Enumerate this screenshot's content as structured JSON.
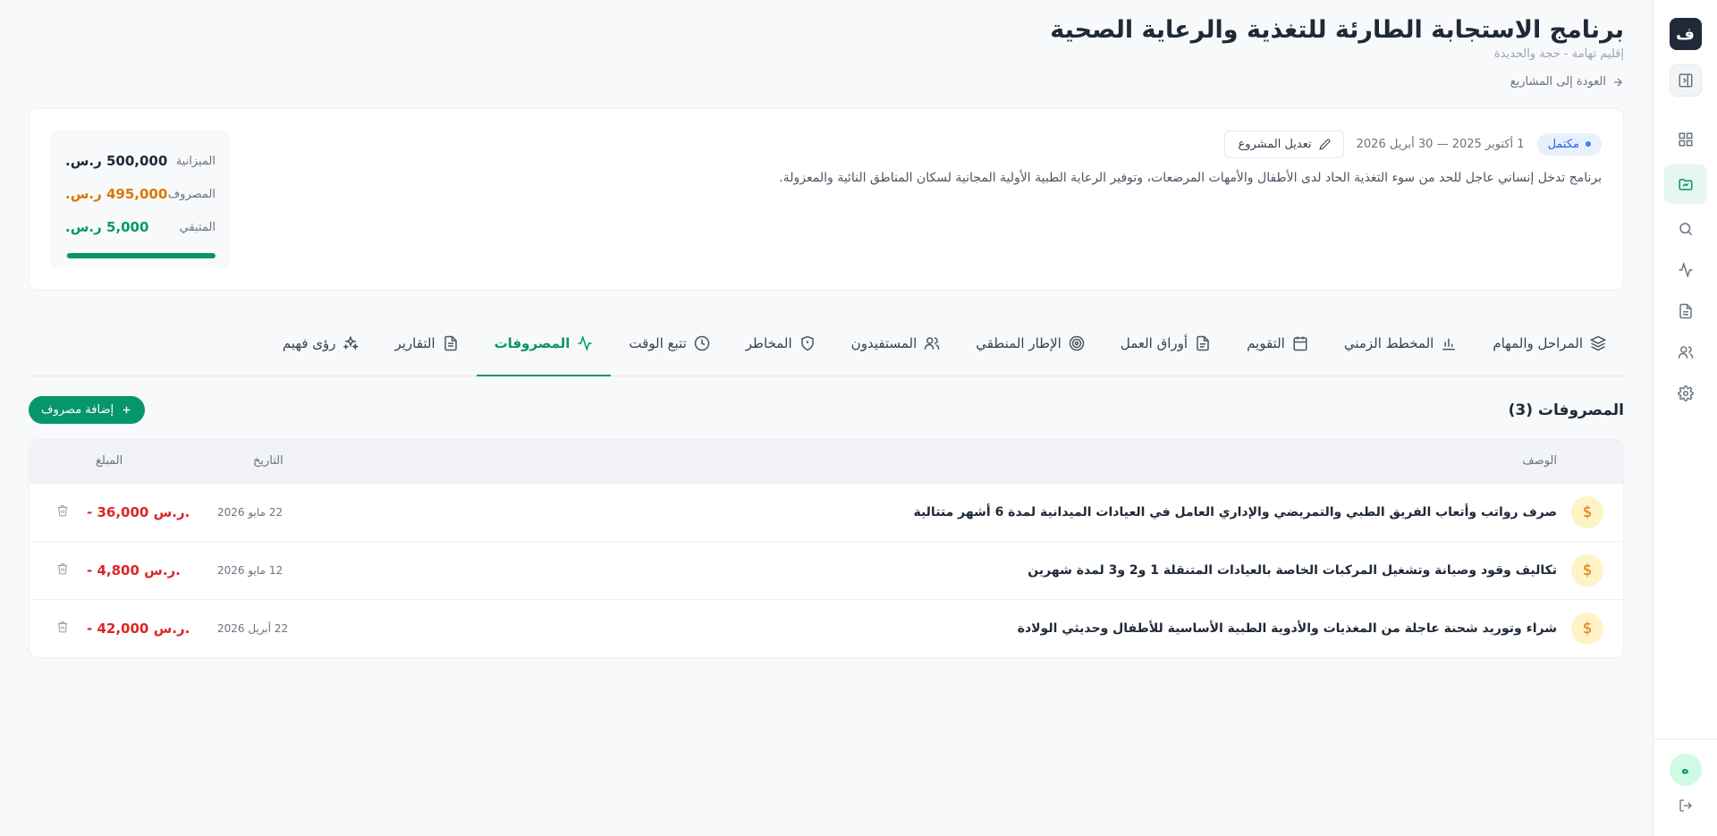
{
  "app": {
    "logo_glyph": "ف",
    "avatar_initial": "ه"
  },
  "rail": {
    "items": [
      {
        "icon": "sidebar-toggle-icon"
      },
      {
        "icon": "dashboard-grid-icon"
      },
      {
        "icon": "projects-folder-icon"
      },
      {
        "icon": "search-icon"
      },
      {
        "icon": "activity-icon"
      },
      {
        "icon": "document-icon"
      },
      {
        "icon": "users-icon"
      },
      {
        "icon": "gear-icon"
      }
    ]
  },
  "project": {
    "title": "برنامج الاستجابة الطارئة للتغذية والرعاية الصحية",
    "location": "إقليم تهامة - حجة والحديدة",
    "back_label": "العودة إلى المشاريع",
    "status": "مكتمل",
    "dates": "1 أكتوبر 2025 — 30 أبريل 2026",
    "edit_label": "تعديل المشروع",
    "description": "برنامج تدخل إنساني عاجل للحد من سوء التغذية الحاد لدى الأطفال والأمهات المرضعات، وتوفير الرعاية الطبية الأولية المجانية لسكان المناطق النائية والمعزولة."
  },
  "budget": {
    "budget_label": "الميزانية",
    "budget_value": "500,000 ر.س.",
    "spent_label": "المصروف",
    "spent_value": "495,000 ر.س.",
    "remaining_label": "المتبقي",
    "remaining_value": "5,000 ر.س.",
    "spent_fraction": 0.99
  },
  "tabs": [
    {
      "label": "المراحل والمهام",
      "icon": "layers-icon"
    },
    {
      "label": "المخطط الزمني",
      "icon": "bar-chart-icon"
    },
    {
      "label": "التقويم",
      "icon": "calendar-icon"
    },
    {
      "label": "أوراق العمل",
      "icon": "file-icon"
    },
    {
      "label": "الإطار المنطقي",
      "icon": "target-icon"
    },
    {
      "label": "المستفيدون",
      "icon": "users-icon"
    },
    {
      "label": "المخاطر",
      "icon": "shield-icon"
    },
    {
      "label": "تتبع الوقت",
      "icon": "clock-icon"
    },
    {
      "label": "المصروفات",
      "icon": "activity-icon",
      "active": true
    },
    {
      "label": "التقارير",
      "icon": "file-text-icon"
    },
    {
      "label": "رؤى فهيم",
      "icon": "sparkles-icon"
    }
  ],
  "expenses": {
    "title": "المصروفات (3)",
    "add_label": "إضافة مصروف",
    "columns": {
      "description": "الوصف",
      "date": "التاريخ",
      "amount": "المبلغ"
    },
    "rows": [
      {
        "description": "صرف رواتب وأتعاب الفريق الطبي والتمريضي والإداري العامل في العيادات الميدانية لمدة 6 أشهر متتالية",
        "date": "22 مايو 2026",
        "amount": "- 36,000 ر.س."
      },
      {
        "description": "تكاليف وقود وصيانة وتشغيل المركبات الخاصة بالعيادات المتنقلة 1 و2 و3 لمدة شهرين",
        "date": "12 مايو 2026",
        "amount": "- 4,800 ر.س."
      },
      {
        "description": "شراء وتوريد شحنة عاجلة من المغذيات والأدوية الطبية الأساسية للأطفال وحديثي الولادة",
        "date": "22 أبريل 2026",
        "amount": "- 42,000 ر.س."
      }
    ]
  },
  "colors": {
    "accent": "#059669",
    "spent": "#d97706",
    "negative": "#dc2626",
    "status": "#2563eb"
  }
}
